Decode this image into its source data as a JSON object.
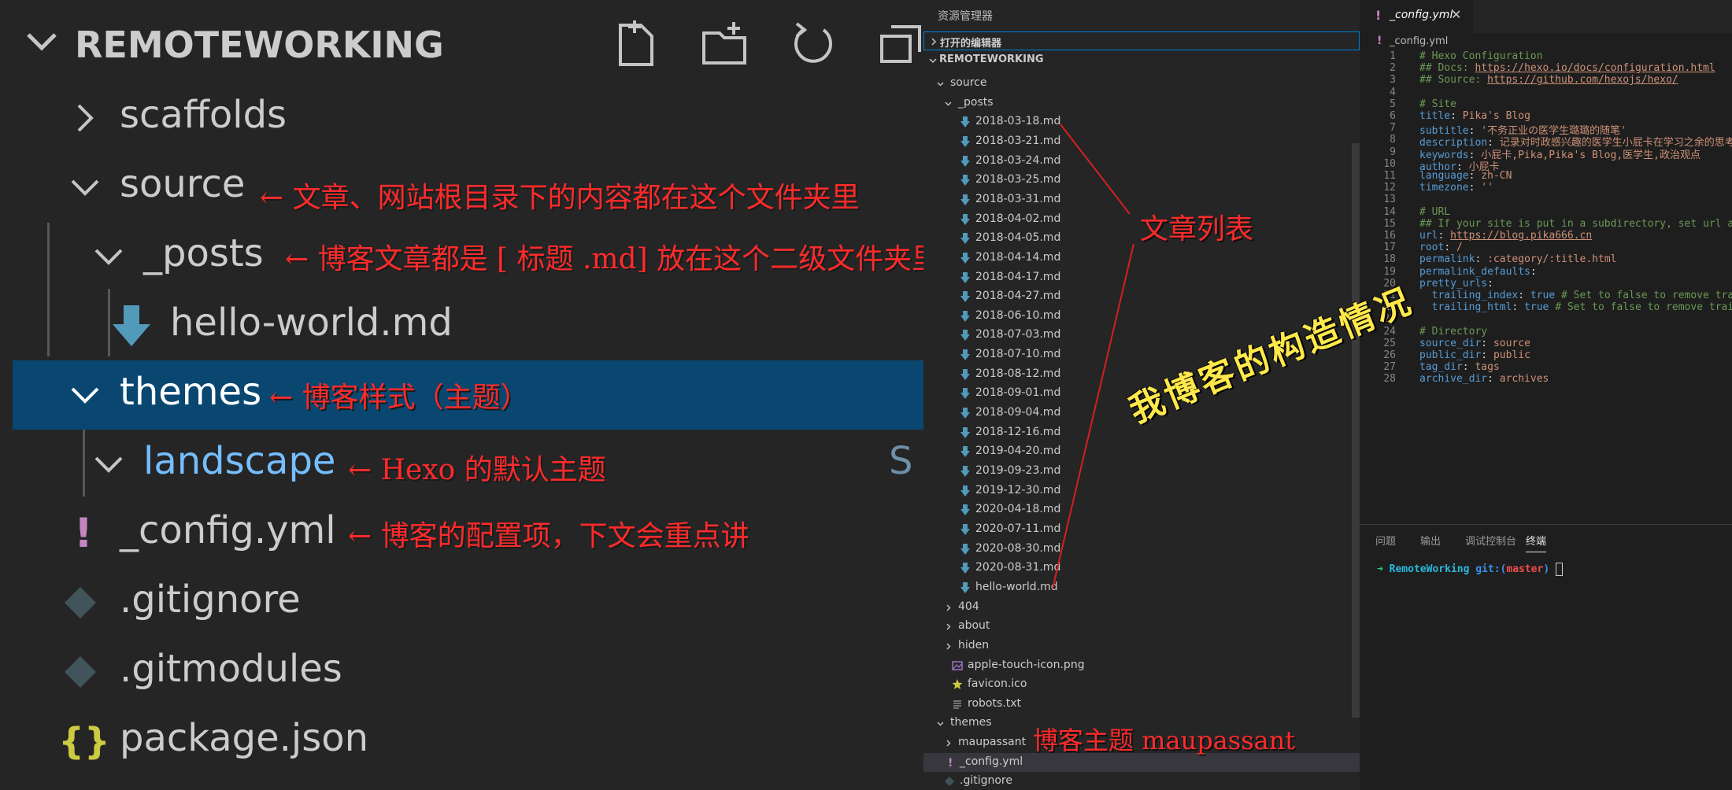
{
  "left": {
    "section_title": "REMOTEWORKING",
    "rows": {
      "scaffolds": "scaffolds",
      "source": "source",
      "posts": "_posts",
      "hello": "hello-world.md",
      "themes": "themes",
      "landscape": "landscape",
      "landscape_badge": "S",
      "config": "_config.yml",
      "gitignore": ".gitignore",
      "gitmodules": ".gitmodules",
      "package": "package.json"
    },
    "glyphs": {
      "config": "!",
      "package": "{}"
    },
    "notes": {
      "source": "← 文章、网站根目录下的内容都在这个文件夹里",
      "posts": "← 博客文章都是 [ 标题 .md] 放在这个二级文件夹里",
      "themes": "← 博客样式（主题）",
      "landscape": "← Hexo 的默认主题",
      "config": "← 博客的配置项，下文会重点讲"
    }
  },
  "explorer": {
    "header": "资源管理器",
    "open_editors": "打开的编辑器",
    "workspace": "REMOTEWORKING",
    "source": "source",
    "posts": "_posts",
    "post_files": [
      "2018-03-18.md",
      "2018-03-21.md",
      "2018-03-24.md",
      "2018-03-25.md",
      "2018-03-31.md",
      "2018-04-02.md",
      "2018-04-05.md",
      "2018-04-14.md",
      "2018-04-17.md",
      "2018-04-27.md",
      "2018-06-10.md",
      "2018-07-03.md",
      "2018-07-10.md",
      "2018-08-12.md",
      "2018-09-01.md",
      "2018-09-04.md",
      "2018-12-16.md",
      "2019-04-20.md",
      "2019-09-23.md",
      "2019-12-30.md",
      "2020-04-18.md",
      "2020-07-11.md",
      "2020-08-30.md",
      "2020-08-31.md",
      "hello-world.md"
    ],
    "folders": [
      "404",
      "about",
      "hiden"
    ],
    "files": [
      "apple-touch-icon.png",
      "favicon.ico",
      "robots.txt"
    ],
    "themes": "themes",
    "theme_folder": "maupassant",
    "config": "_config.yml",
    "gitignore": ".gitignore"
  },
  "editor": {
    "tab_name": "_config.yml",
    "tab_close": "✕",
    "breadcrumb": "_config.yml",
    "lines": [
      {
        "n": "1",
        "segs": [
          [
            "c",
            "# Hexo Configuration"
          ]
        ]
      },
      {
        "n": "2",
        "segs": [
          [
            "c",
            "## Docs: "
          ],
          [
            "u",
            "https://hexo.io/docs/configuration.html"
          ]
        ]
      },
      {
        "n": "3",
        "segs": [
          [
            "c",
            "## Source: "
          ],
          [
            "u",
            "https://github.com/hexojs/hexo/"
          ]
        ]
      },
      {
        "n": "4",
        "segs": []
      },
      {
        "n": "5",
        "segs": [
          [
            "c",
            "# Site"
          ]
        ]
      },
      {
        "n": "6",
        "segs": [
          [
            "k",
            "title"
          ],
          [
            "p",
            ": "
          ],
          [
            "s",
            "Pika's Blog"
          ]
        ]
      },
      {
        "n": "7",
        "segs": [
          [
            "k",
            "subtitle"
          ],
          [
            "p",
            ": "
          ],
          [
            "s",
            "'不务正业の医学生璐璐的随笔'"
          ]
        ]
      },
      {
        "n": "8",
        "segs": [
          [
            "k",
            "description"
          ],
          [
            "p",
            ": "
          ],
          [
            "s",
            "记录对时政感兴趣的医学生小屁卡在学习之余的思考"
          ]
        ]
      },
      {
        "n": "9",
        "segs": [
          [
            "k",
            "keywords"
          ],
          [
            "p",
            ": "
          ],
          [
            "s",
            "小屁卡,Pika,Pika's Blog,医学生,政治观点"
          ]
        ]
      },
      {
        "n": "10",
        "segs": [
          [
            "k",
            "author"
          ],
          [
            "p",
            ": "
          ],
          [
            "s",
            "小屁卡"
          ]
        ]
      },
      {
        "n": "11",
        "segs": [
          [
            "k",
            "language"
          ],
          [
            "p",
            ": "
          ],
          [
            "s",
            "zh-CN"
          ]
        ]
      },
      {
        "n": "12",
        "segs": [
          [
            "k",
            "timezone"
          ],
          [
            "p",
            ": "
          ],
          [
            "s",
            "''"
          ]
        ]
      },
      {
        "n": "13",
        "segs": []
      },
      {
        "n": "14",
        "segs": [
          [
            "c",
            "# URL"
          ]
        ]
      },
      {
        "n": "15",
        "segs": [
          [
            "c",
            "## If your site is put in a subdirectory, set url as"
          ]
        ]
      },
      {
        "n": "16",
        "segs": [
          [
            "k",
            "url"
          ],
          [
            "p",
            ": "
          ],
          [
            "u",
            "https://blog.pika666.cn"
          ]
        ]
      },
      {
        "n": "17",
        "segs": [
          [
            "k",
            "root"
          ],
          [
            "p",
            ": "
          ],
          [
            "s",
            "/"
          ]
        ]
      },
      {
        "n": "18",
        "segs": [
          [
            "k",
            "permalink"
          ],
          [
            "p",
            ": "
          ],
          [
            "s",
            ":category/:title.html"
          ]
        ]
      },
      {
        "n": "19",
        "segs": [
          [
            "k",
            "permalink_defaults"
          ],
          [
            "p",
            ":"
          ]
        ]
      },
      {
        "n": "20",
        "segs": [
          [
            "k",
            "pretty_urls"
          ],
          [
            "p",
            ":"
          ]
        ]
      },
      {
        "n": "21",
        "segs": [
          [
            "p",
            "  "
          ],
          [
            "k",
            "trailing_index"
          ],
          [
            "p",
            ": "
          ],
          [
            "b",
            "true"
          ],
          [
            "c",
            " # Set to false to remove trailing 'index.html'"
          ]
        ]
      },
      {
        "n": "22",
        "segs": [
          [
            "p",
            "  "
          ],
          [
            "k",
            "trailing_html"
          ],
          [
            "p",
            ": "
          ],
          [
            "b",
            "true"
          ],
          [
            "c",
            " # Set to false to remove trailing '.html'"
          ]
        ]
      },
      {
        "n": "23",
        "segs": []
      },
      {
        "n": "24",
        "segs": [
          [
            "c",
            "# Directory"
          ]
        ]
      },
      {
        "n": "25",
        "segs": [
          [
            "k",
            "source_dir"
          ],
          [
            "p",
            ": "
          ],
          [
            "s",
            "source"
          ]
        ]
      },
      {
        "n": "26",
        "segs": [
          [
            "k",
            "public_dir"
          ],
          [
            "p",
            ": "
          ],
          [
            "s",
            "public"
          ]
        ]
      },
      {
        "n": "27",
        "segs": [
          [
            "k",
            "tag_dir"
          ],
          [
            "p",
            ": "
          ],
          [
            "s",
            "tags"
          ]
        ]
      },
      {
        "n": "28",
        "segs": [
          [
            "k",
            "archive_dir"
          ],
          [
            "p",
            ": "
          ],
          [
            "s",
            "archives"
          ]
        ]
      }
    ],
    "current_line": "22"
  },
  "panel": {
    "tabs": [
      "问题",
      "输出",
      "调试控制台",
      "终端"
    ],
    "active": "终端",
    "terminal": {
      "arrow": "➜",
      "dir": "RemoteWorking",
      "git": "git:(",
      "branch": "master",
      "close": ")"
    }
  },
  "annotations": {
    "article_list": "文章列表",
    "theme_note": "博客主题 maupassant",
    "structure": "我博客的构造情况"
  },
  "colors": {
    "selection": "#094771",
    "annotation_red": "#ff2b2b",
    "annotation_yellow": "#ffe84a",
    "md_icon": "#519aba",
    "yaml_icon": "#c586c0",
    "json_icon": "#cbcb41"
  }
}
